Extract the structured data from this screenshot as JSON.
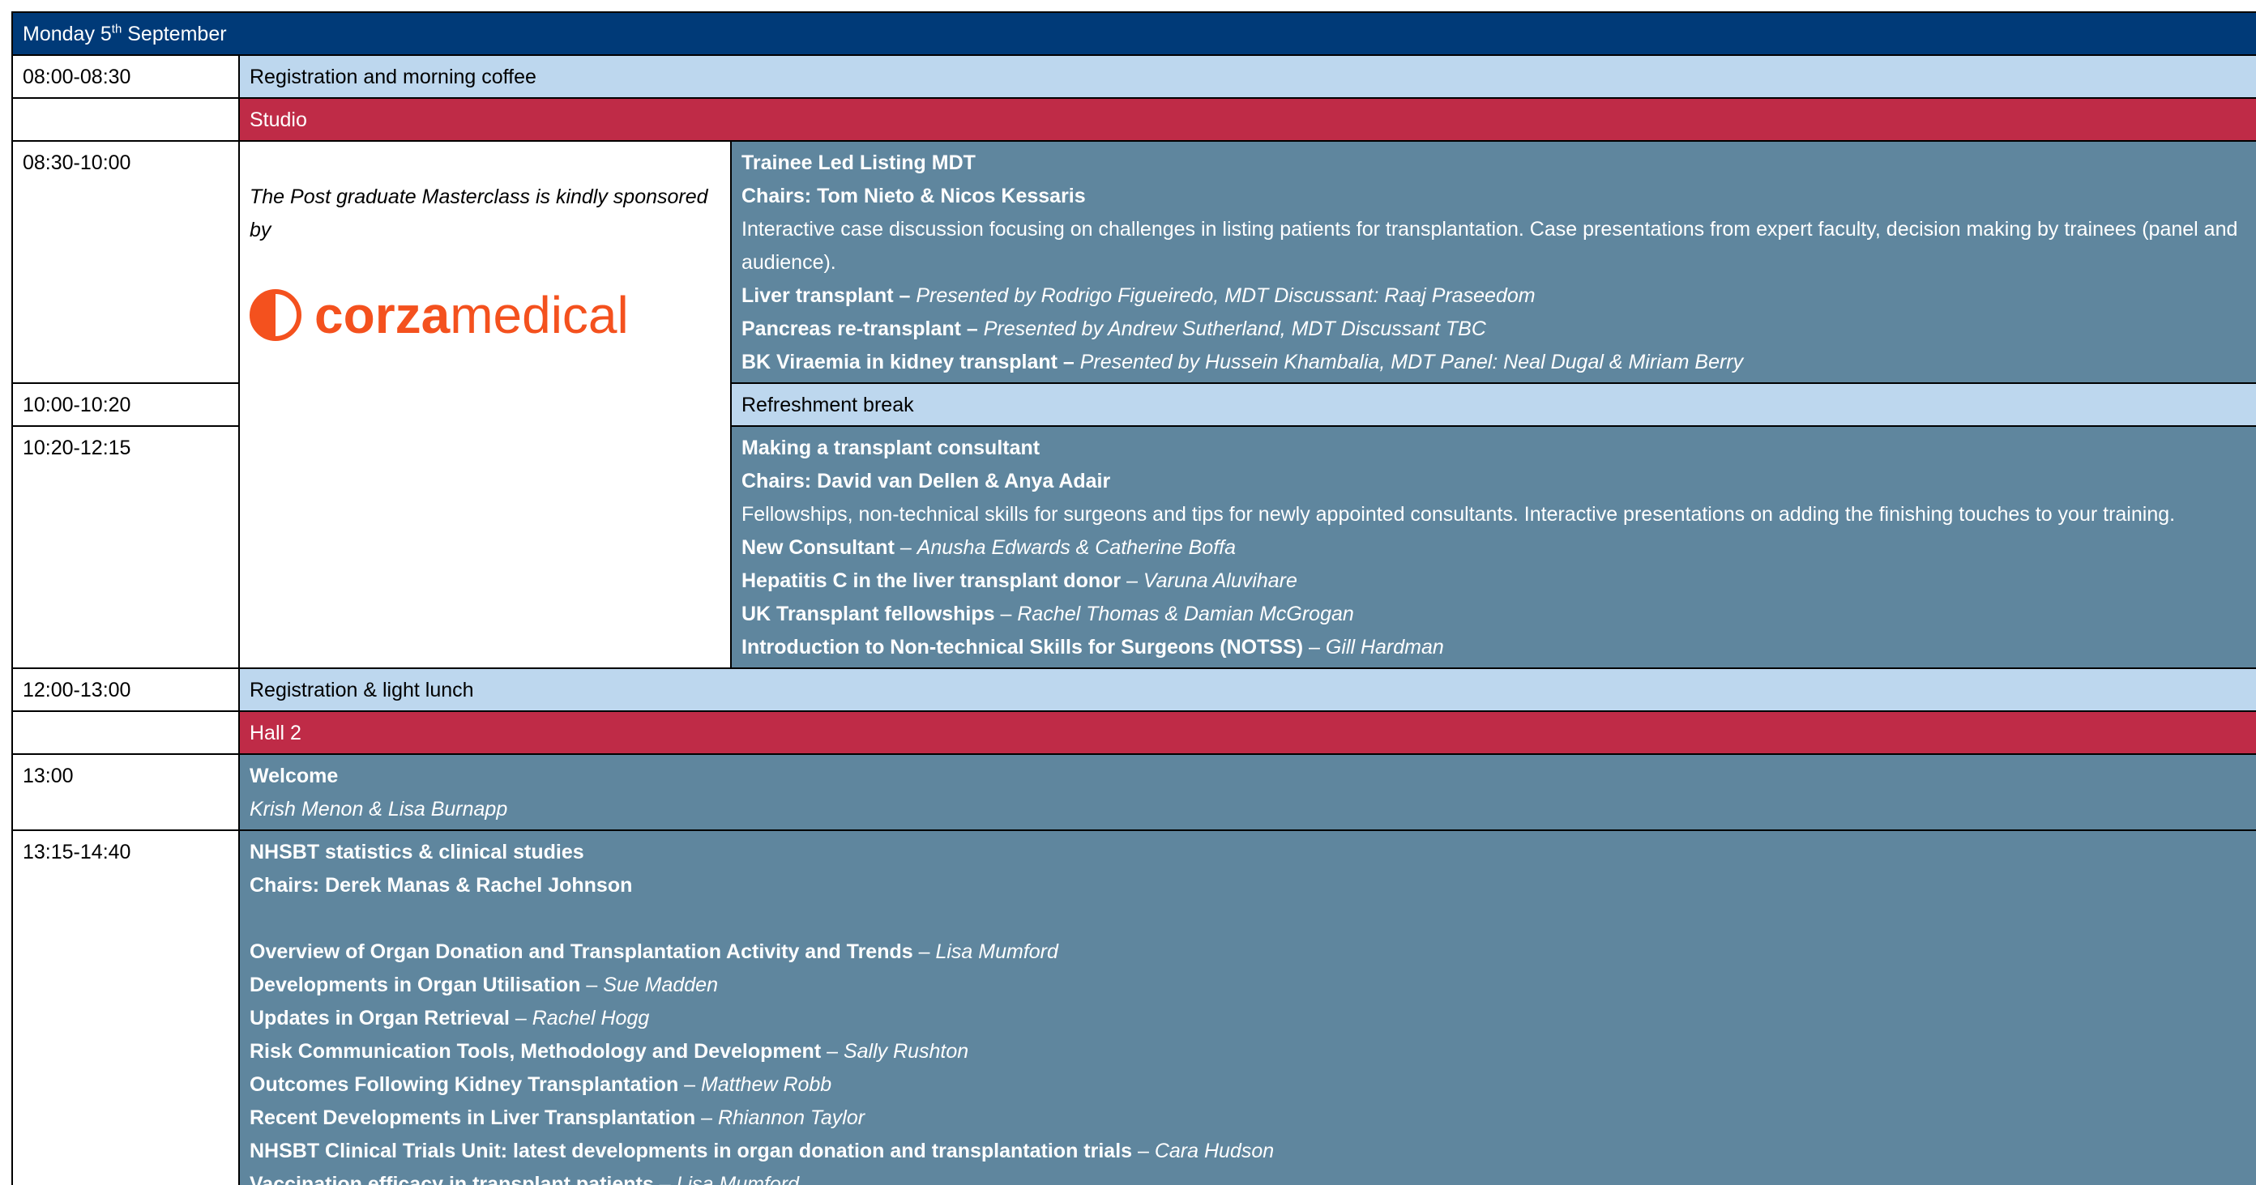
{
  "header": {
    "day": "Monday 5",
    "sup": "th",
    "month": " September"
  },
  "rows": {
    "r0800": {
      "time": "08:00-08:30",
      "title": "Registration and morning coffee"
    },
    "studio": {
      "label": "Studio"
    },
    "r0830": {
      "time": "08:30-10:00",
      "title": "Trainee Led Listing MDT",
      "chairs": "Chairs: Tom Nieto & Nicos Kessaris",
      "desc": "Interactive case discussion focusing on challenges in listing patients for transplantation. Case presentations from expert faculty, decision making by trainees (panel and audience).",
      "items": [
        {
          "b": "Liver transplant – ",
          "i": "Presented by Rodrigo Figueiredo, MDT Discussant: Raaj Praseedom"
        },
        {
          "b": "Pancreas re-transplant – ",
          "i": "Presented by Andrew Sutherland, MDT Discussant TBC"
        },
        {
          "b": "BK Viraemia in kidney transplant – ",
          "i": "Presented by Hussein Khambalia, MDT Panel: Neal Dugal & Miriam Berry"
        }
      ]
    },
    "sponsor": {
      "text": "The Post graduate Masterclass is kindly sponsored by",
      "logo_bold": "corza",
      "logo_rest": "medical"
    },
    "r1000": {
      "time": "10:00-10:20",
      "title": "Refreshment break"
    },
    "r1020": {
      "time": "10:20-12:15",
      "title": "Making a transplant consultant",
      "chairs": "Chairs: David van Dellen & Anya Adair",
      "desc": "Fellowships, non-technical skills for surgeons and tips for newly appointed consultants. Interactive presentations on adding the finishing touches to your training.",
      "items": [
        {
          "b": "New Consultant",
          "n": " – ",
          "i": "Anusha Edwards & Catherine Boffa"
        },
        {
          "b": "Hepatitis C in the liver transplant donor",
          "n": " – ",
          "i": "Varuna Aluvihare"
        },
        {
          "b": "UK Transplant fellowships",
          "n": " – ",
          "i": "Rachel Thomas & Damian McGrogan"
        },
        {
          "b": "Introduction to Non-technical Skills for Surgeons (NOTSS)",
          "n": "  – ",
          "i": "Gill Hardman"
        }
      ]
    },
    "r1200": {
      "time": "12:00-13:00",
      "title": "Registration & light lunch"
    },
    "hall2": {
      "label": "Hall 2"
    },
    "r1300": {
      "time": "13:00",
      "title": "Welcome",
      "speakers": "Krish Menon & Lisa Burnapp"
    },
    "r1315": {
      "time": "13:15-14:40",
      "title": "NHSBT statistics & clinical studies",
      "chairs": "Chairs: Derek Manas & Rachel Johnson",
      "items": [
        {
          "b": "Overview of Organ Donation and Transplantation Activity and Trends",
          "n": " – ",
          "i": "Lisa Mumford"
        },
        {
          "b": "Developments in Organ Utilisation",
          "n": " – ",
          "i": "Sue Madden"
        },
        {
          "b": "Updates in Organ Retrieval",
          "n": " – ",
          "i": "Rachel Hogg"
        },
        {
          "b": "Risk Communication Tools, Methodology and Development",
          "n": " – ",
          "i": "Sally Rushton"
        },
        {
          "b": "Outcomes Following Kidney Transplantation",
          "n": " – ",
          "i": "Matthew Robb"
        },
        {
          "b": "Recent Developments in Liver Transplantation",
          "n": " – ",
          "i": "Rhiannon Taylor"
        },
        {
          "b": "NHSBT Clinical Trials Unit: latest developments in organ donation and transplantation trials",
          "n": " – ",
          "i": "Cara Hudson"
        },
        {
          "b": "Vaccination efficacy in transplant patients",
          "n": " – ",
          "i": "Lisa Mumford"
        }
      ]
    }
  }
}
